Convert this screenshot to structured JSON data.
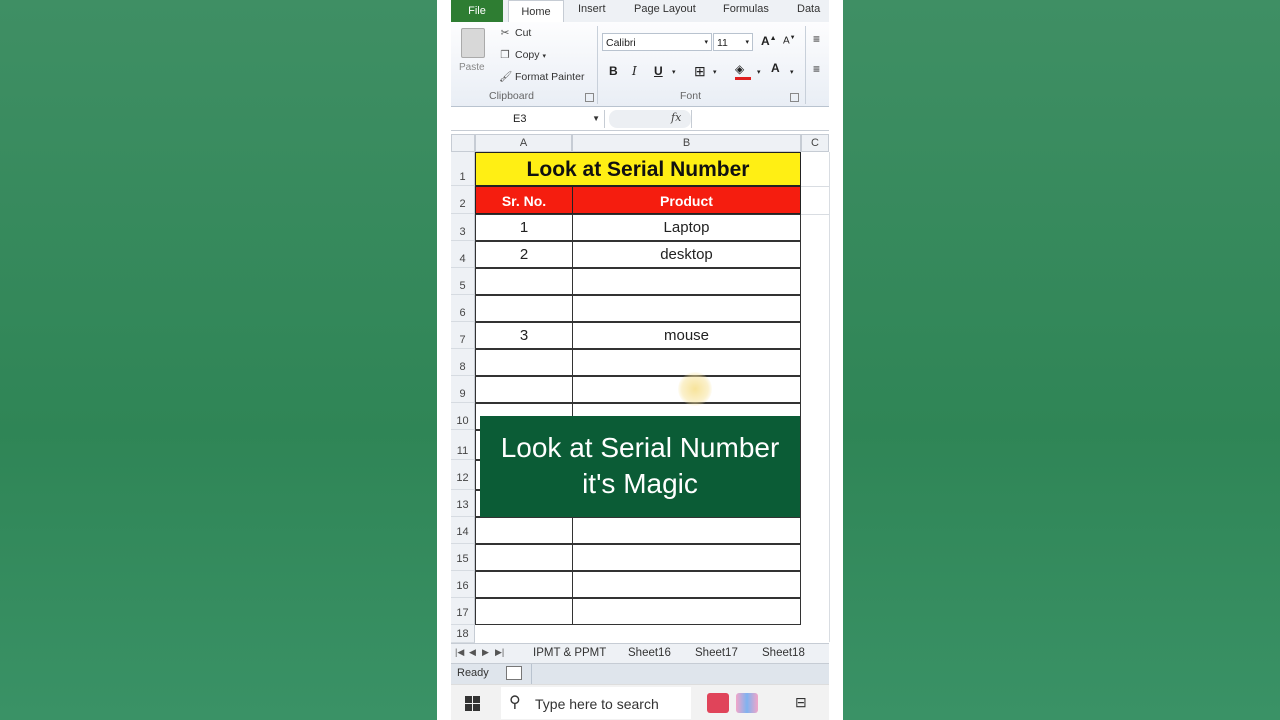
{
  "ribbon": {
    "tabs": [
      "File",
      "Home",
      "Insert",
      "Page Layout",
      "Formulas",
      "Data"
    ],
    "clipboard": {
      "paste": "Paste",
      "cut": "Cut",
      "copy": "Copy",
      "format_painter": "Format Painter",
      "group_label": "Clipboard"
    },
    "font": {
      "family": "Calibri",
      "size": "11",
      "group_label": "Font",
      "bold": "B",
      "italic": "I",
      "underline": "U",
      "font_color": "A"
    }
  },
  "formula_bar": {
    "name_box": "E3",
    "fx": "fx"
  },
  "columns": [
    "A",
    "B",
    "C"
  ],
  "rows": [
    "1",
    "2",
    "3",
    "4",
    "5",
    "6",
    "7",
    "8",
    "9",
    "10",
    "11",
    "12",
    "13",
    "14",
    "15",
    "16",
    "17",
    "18"
  ],
  "sheet": {
    "title": "Look at Serial Number",
    "headers": [
      "Sr. No.",
      "Product"
    ],
    "data": [
      {
        "row": 3,
        "sr": "1",
        "product": "Laptop"
      },
      {
        "row": 4,
        "sr": "2",
        "product": "desktop"
      },
      {
        "row": 7,
        "sr": "3",
        "product": "mouse"
      }
    ],
    "colors": {
      "title_bg": "#ffef14",
      "header_bg": "#f51d0f"
    }
  },
  "overlay": {
    "line1": "Look at Serial Number",
    "line2": "it's Magic"
  },
  "sheet_tabs": [
    "IPMT & PPMT",
    "Sheet16",
    "Sheet17",
    "Sheet18"
  ],
  "status": "Ready",
  "taskbar": {
    "search_placeholder": "Type here to search"
  }
}
